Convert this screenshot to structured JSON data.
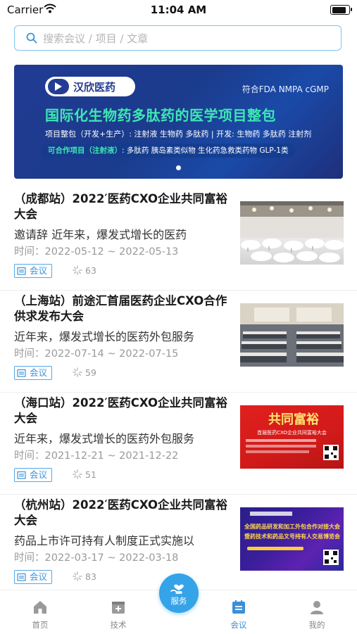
{
  "status_bar": {
    "carrier": "Carrier",
    "time": "11:04 AM"
  },
  "search": {
    "placeholder": "搜索会议 / 项目 / 文章"
  },
  "banner": {
    "brand": "汉欣医药",
    "standard": "符合FDA NMPA cGMP",
    "headline": "国际化生物药多肽药的医学项目整包",
    "line2": "项目整包（开发+生产）: 注射液 生物药 多肽药 | 开发: 生物药 多肽药 注射剂",
    "line3_label": "可合作项目（注射液）",
    "line3_text": ": 多肽药 胰岛素类似物 生化药急救类药物 GLP-1类"
  },
  "items": [
    {
      "title": "（成都站）2022′医药CXO企业共同富裕大会",
      "desc": "邀请辞 近年来，爆发式增长的医药",
      "time": "时间：2022-05-12 ~ 2022-05-13",
      "tag": "会议",
      "views": "63"
    },
    {
      "title": "（上海站）前途汇首届医药企业CXO合作供求发布大会",
      "desc": "近年来，爆发式增长的医药外包服务",
      "time": "时间：2022-07-14 ~ 2022-07-15",
      "tag": "会议",
      "views": "59"
    },
    {
      "title": "（海口站）2022′医药CXO企业共同富裕大会",
      "desc": "近年来，爆发式增长的医药外包服务",
      "time": "时间：2021-12-21 ~ 2021-12-22",
      "tag": "会议",
      "views": "51"
    },
    {
      "title": "（杭州站）2022′医药CXO企业共同富裕大会",
      "desc": "药品上市许可持有人制度正式实施以",
      "time": "时间：2022-03-17 ~ 2022-03-18",
      "tag": "会议",
      "views": "83"
    }
  ],
  "thumb3": {
    "title": "共同富裕",
    "sub": "首届医药CXO企业共同富裕大会"
  },
  "thumb4": {
    "line1": "全国药品研发和加工外包合作对接大会",
    "line2": "暨药技术和药品文号持有人交易博览会"
  },
  "tabbar": {
    "home": "首页",
    "tech": "技术",
    "service": "服务",
    "meeting": "会议",
    "mine": "我的"
  },
  "colors": {
    "accent": "#35a3e8",
    "active_tab": "#3b8fd8",
    "banner_bg": "#1b3b8c",
    "banner_headline": "#3ee6b3"
  }
}
